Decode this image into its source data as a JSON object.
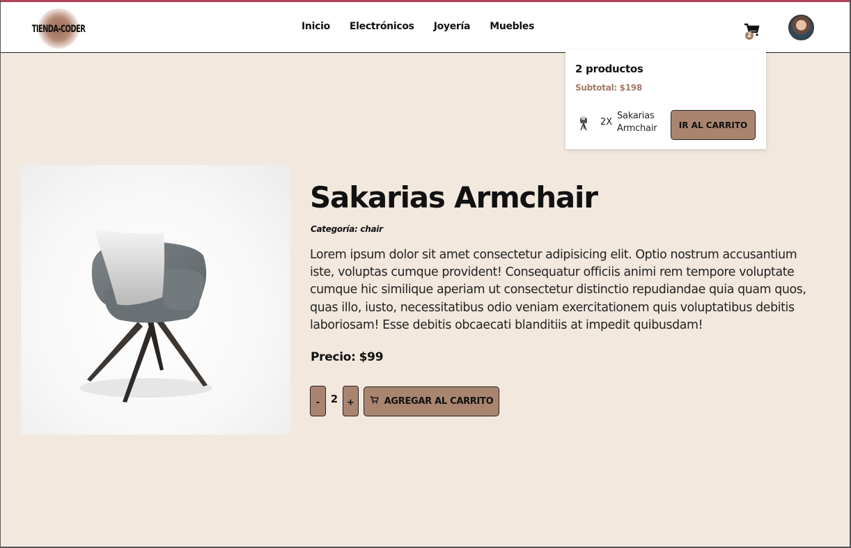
{
  "brand": {
    "logo_text": "TIENDA-CODER"
  },
  "nav": {
    "items": [
      {
        "label": "Inicio"
      },
      {
        "label": "Electrónicos"
      },
      {
        "label": "Joyería"
      },
      {
        "label": "Muebles"
      }
    ]
  },
  "cart": {
    "badge_count": "2",
    "panel": {
      "title": "2 productos",
      "subtotal": "Subtotal: $198",
      "item_qty": "2X",
      "item_name": "Sakarias Armchair",
      "button_label": "IR AL CARRITO"
    }
  },
  "product": {
    "title": "Sakarias Armchair",
    "category": "Categoría: chair",
    "description": "Lorem ipsum dolor sit amet consectetur adipisicing elit. Optio nostrum accusantium iste, voluptas cumque provident! Consequatur officiis animi rem tempore voluptate cumque hic similique aperiam ut consectetur distinctio repudiandae quia quam quos, quas illo, iusto, necessitatibus odio veniam exercitationem quis voluptatibus debitis laboriosam! Esse debitis obcaecati blanditiis at impedit quibusdam!",
    "price_label": "Precio:",
    "price_value": "$99",
    "quantity": "2",
    "minus_label": "-",
    "plus_label": "+",
    "add_button_label": "AGREGAR AL CARRITO"
  },
  "colors": {
    "page_bg": "#f2e8de",
    "accent": "#a98570",
    "top_border": "#b04256"
  },
  "icons": [
    "cart-icon",
    "avatar",
    "chair-product-image"
  ]
}
